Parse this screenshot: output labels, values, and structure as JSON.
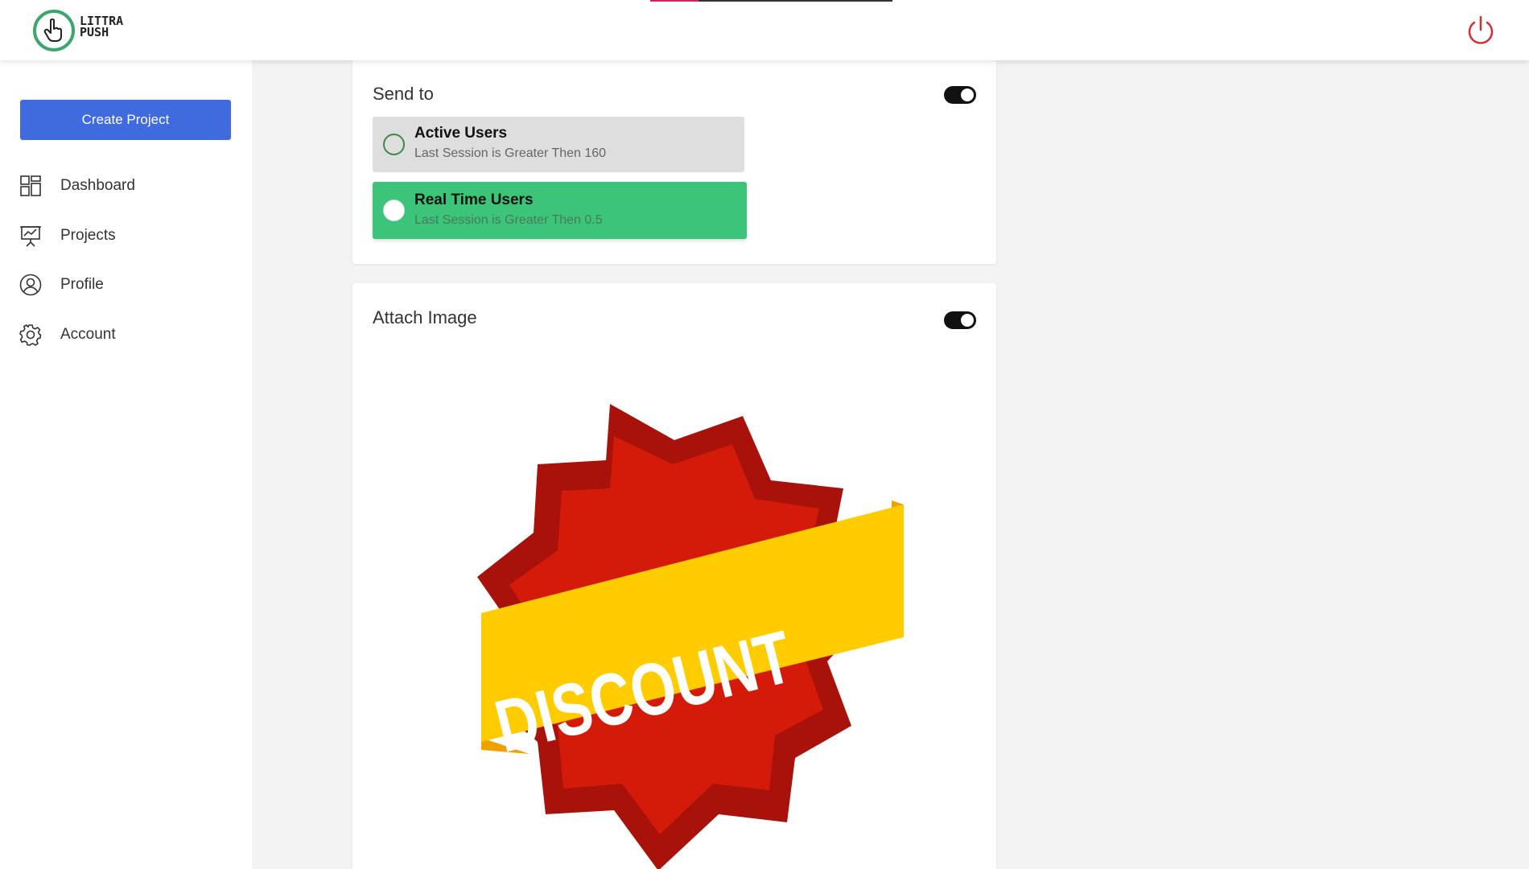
{
  "header": {
    "logo": {
      "line1": "LITTRA",
      "line2": "PUSH",
      "icon": "hand-pointer-icon"
    },
    "power_icon": "power-icon",
    "colors": {
      "logo_ring": "#3aa76d",
      "power": "#d32f2f",
      "indicator_accent": "#d0245e"
    }
  },
  "sidebar": {
    "create_button": "Create Project",
    "items": [
      {
        "label": "Dashboard",
        "icon": "dashboard-icon"
      },
      {
        "label": "Projects",
        "icon": "presentation-icon"
      },
      {
        "label": "Profile",
        "icon": "user-circle-icon"
      },
      {
        "label": "Account",
        "icon": "gear-icon"
      }
    ],
    "colors": {
      "button": "#3f6bde"
    }
  },
  "send_to": {
    "title": "Send to",
    "toggle_on": true,
    "options": [
      {
        "title": "Active Users",
        "subtitle": "Last Session is Greater Then 160",
        "selected": false
      },
      {
        "title": "Real Time Users",
        "subtitle": "Last Session is Greater Then 0.5",
        "selected": true
      }
    ],
    "colors": {
      "selected_bg": "#3bc47a",
      "unselected_bg": "#dedede"
    }
  },
  "attach_image": {
    "title": "Attach Image",
    "toggle_on": true,
    "image": {
      "banner_text": "DISCOUNT",
      "badge_color": "#cc1a0a",
      "ribbon_color": "#ffcc00"
    }
  }
}
